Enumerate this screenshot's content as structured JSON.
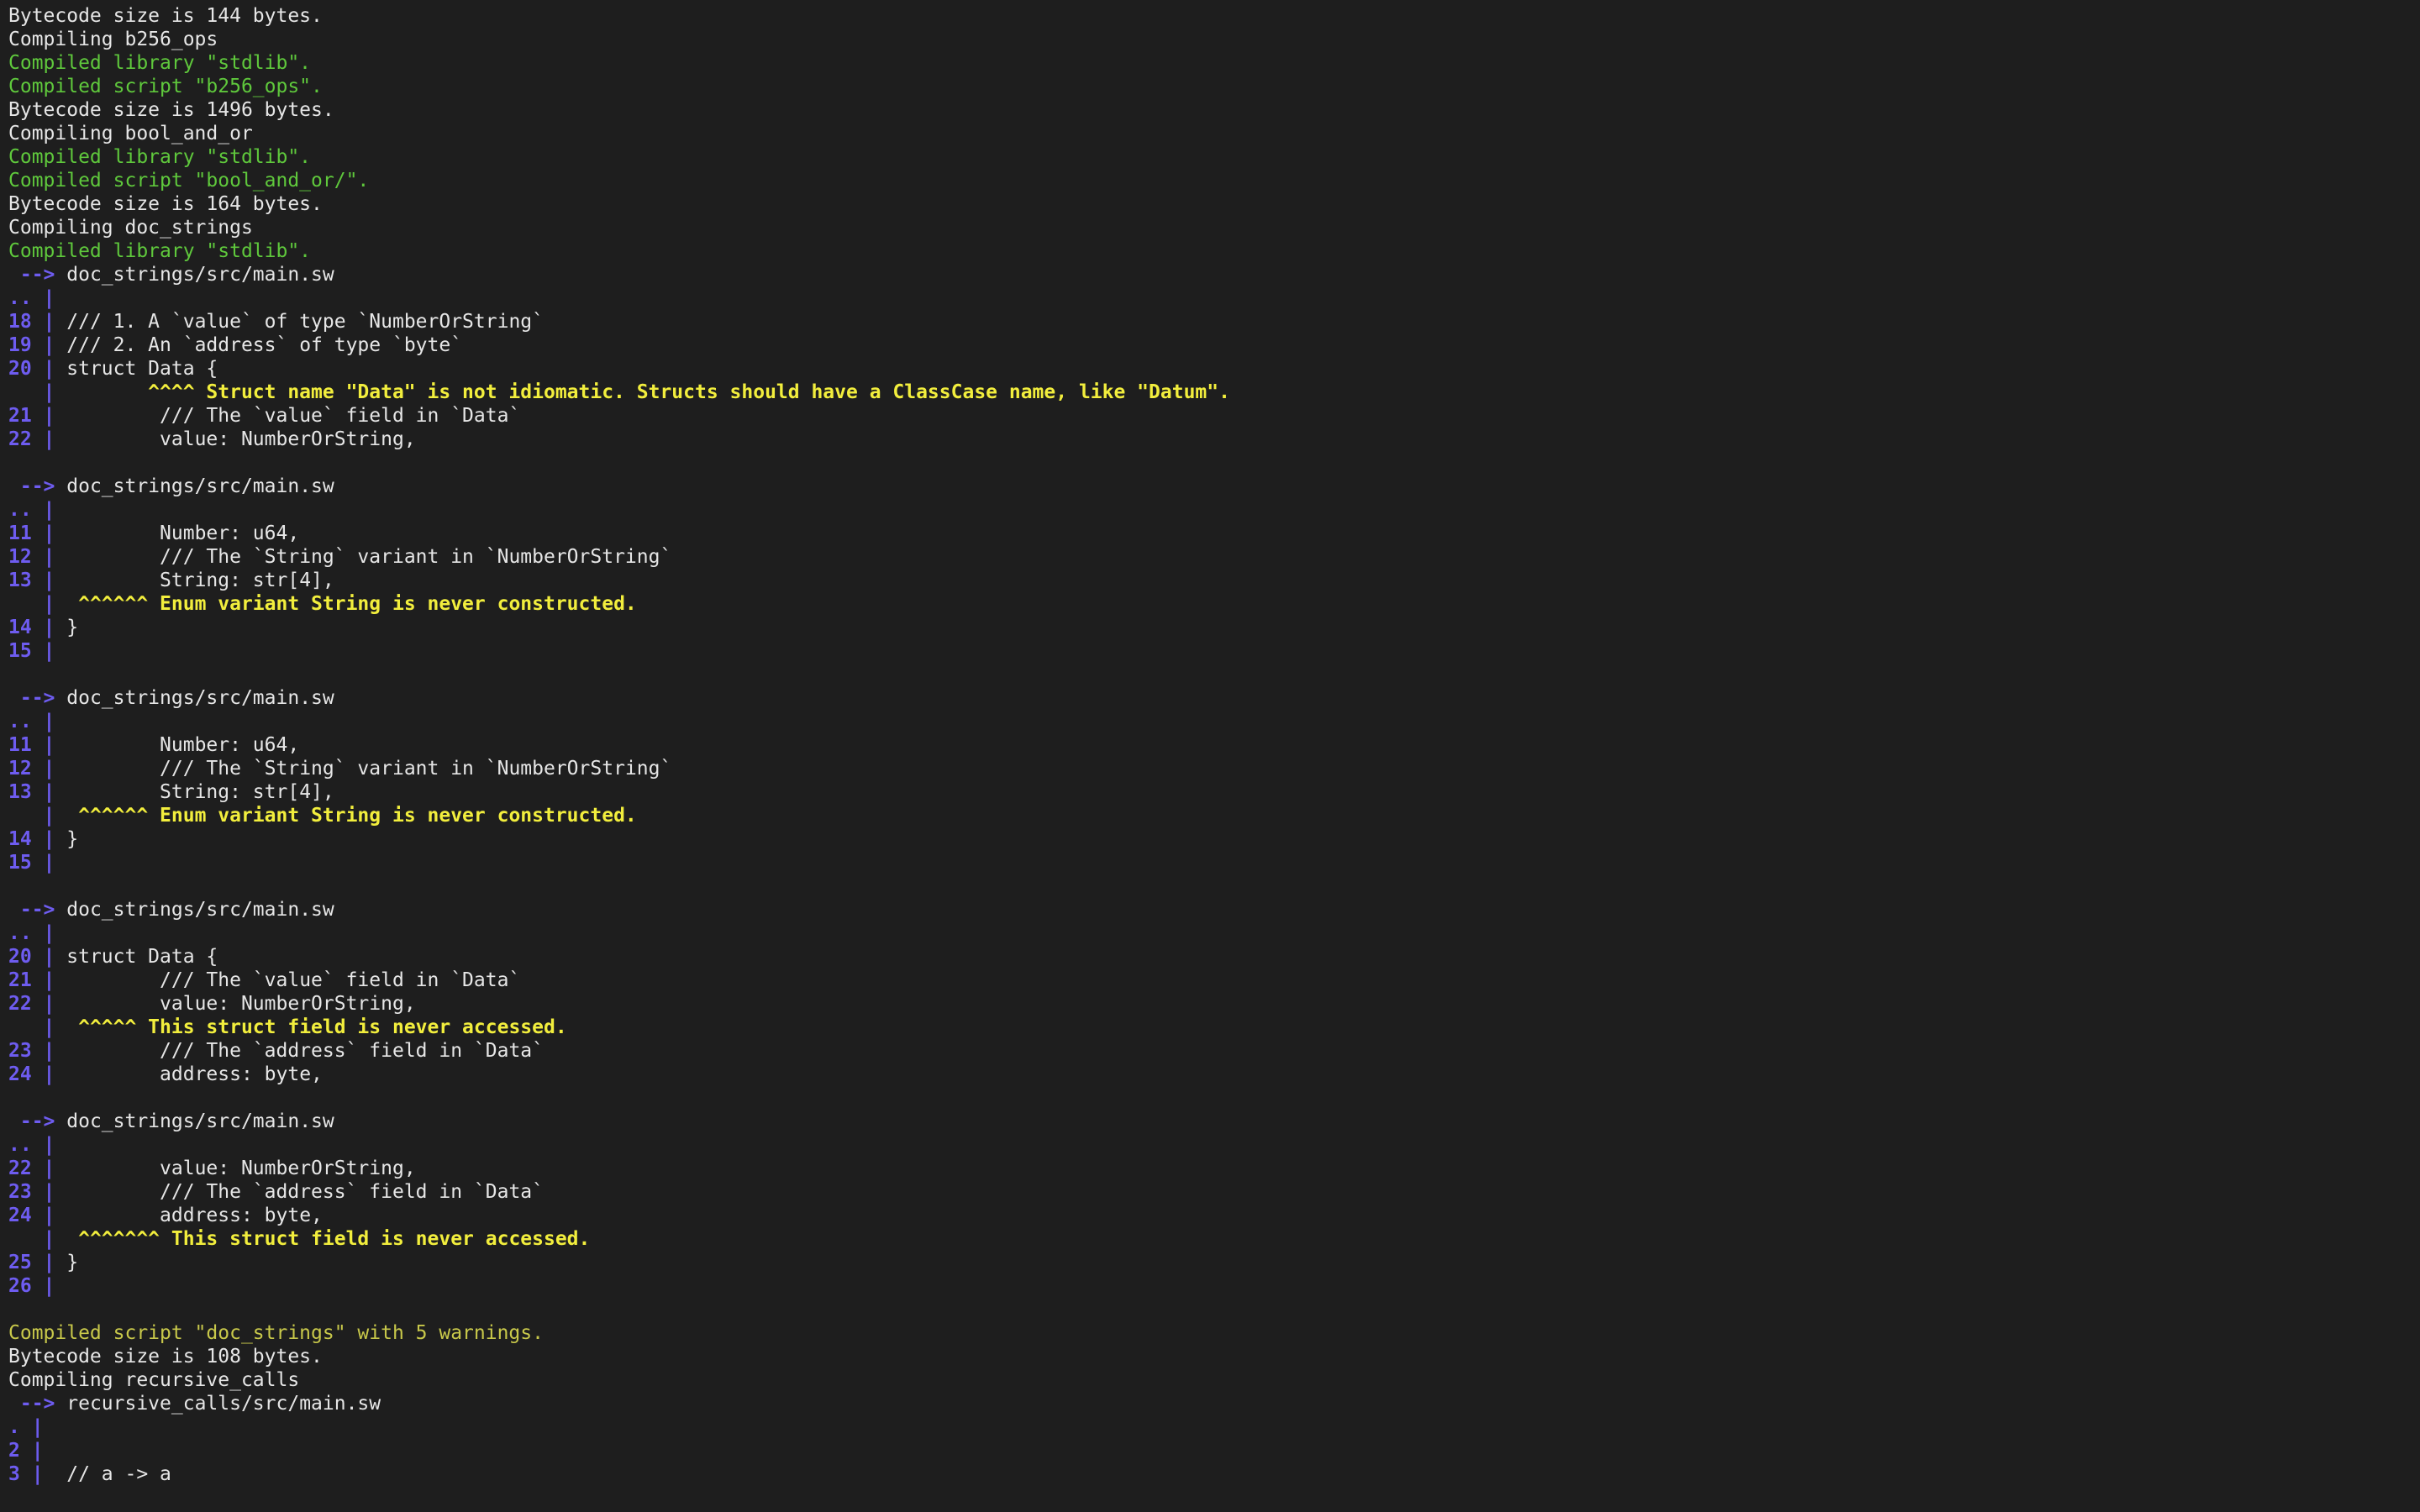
{
  "terminal": {
    "lines": [
      {
        "segments": [
          {
            "text": "Bytecode size is 144 bytes.",
            "style": "plain"
          }
        ]
      },
      {
        "segments": [
          {
            "text": "Compiling b256_ops",
            "style": "plain"
          }
        ]
      },
      {
        "segments": [
          {
            "text": "Compiled library \"stdlib\".",
            "style": "green"
          }
        ]
      },
      {
        "segments": [
          {
            "text": "Compiled script \"b256_ops\".",
            "style": "green"
          }
        ]
      },
      {
        "segments": [
          {
            "text": "Bytecode size is 1496 bytes.",
            "style": "plain"
          }
        ]
      },
      {
        "segments": [
          {
            "text": "Compiling bool_and_or",
            "style": "plain"
          }
        ]
      },
      {
        "segments": [
          {
            "text": "Compiled library \"stdlib\".",
            "style": "green"
          }
        ]
      },
      {
        "segments": [
          {
            "text": "Compiled script \"bool_and_or/\".",
            "style": "green"
          }
        ]
      },
      {
        "segments": [
          {
            "text": "Bytecode size is 164 bytes.",
            "style": "plain"
          }
        ]
      },
      {
        "segments": [
          {
            "text": "Compiling doc_strings",
            "style": "plain"
          }
        ]
      },
      {
        "segments": [
          {
            "text": "Compiled library \"stdlib\".",
            "style": "green"
          }
        ]
      },
      {
        "segments": [
          {
            "text": " --> ",
            "style": "gutter"
          },
          {
            "text": "doc_strings/src/main.sw",
            "style": "plain"
          }
        ]
      },
      {
        "segments": [
          {
            "text": ".. |",
            "style": "gutter"
          }
        ]
      },
      {
        "segments": [
          {
            "text": "18 | ",
            "style": "gutter"
          },
          {
            "text": "/// 1. A `value` of type `NumberOrString`",
            "style": "plain"
          }
        ]
      },
      {
        "segments": [
          {
            "text": "19 | ",
            "style": "gutter"
          },
          {
            "text": "/// 2. An `address` of type `byte`",
            "style": "plain"
          }
        ]
      },
      {
        "segments": [
          {
            "text": "20 | ",
            "style": "gutter"
          },
          {
            "text": "struct Data {",
            "style": "plain"
          }
        ]
      },
      {
        "segments": [
          {
            "text": "   |        ",
            "style": "gutter"
          },
          {
            "text": "^^^^ Struct name \"Data\" is not idiomatic. Structs should have a ClassCase name, like \"Datum\".",
            "style": "warn"
          }
        ]
      },
      {
        "segments": [
          {
            "text": "21 | ",
            "style": "gutter"
          },
          {
            "text": "        /// The `value` field in `Data`",
            "style": "plain"
          }
        ]
      },
      {
        "segments": [
          {
            "text": "22 | ",
            "style": "gutter"
          },
          {
            "text": "        value: NumberOrString,",
            "style": "plain"
          }
        ]
      },
      {
        "segments": [
          {
            "text": "",
            "style": "plain"
          }
        ]
      },
      {
        "segments": [
          {
            "text": " --> ",
            "style": "gutter"
          },
          {
            "text": "doc_strings/src/main.sw",
            "style": "plain"
          }
        ]
      },
      {
        "segments": [
          {
            "text": ".. |",
            "style": "gutter"
          }
        ]
      },
      {
        "segments": [
          {
            "text": "11 | ",
            "style": "gutter"
          },
          {
            "text": "        Number: u64,",
            "style": "plain"
          }
        ]
      },
      {
        "segments": [
          {
            "text": "12 | ",
            "style": "gutter"
          },
          {
            "text": "        /// The `String` variant in `NumberOrString`",
            "style": "plain"
          }
        ]
      },
      {
        "segments": [
          {
            "text": "13 | ",
            "style": "gutter"
          },
          {
            "text": "        String: str[4],",
            "style": "plain"
          }
        ]
      },
      {
        "segments": [
          {
            "text": "   |  ",
            "style": "gutter"
          },
          {
            "text": "^^^^^^ Enum variant String is never constructed.",
            "style": "warn"
          }
        ]
      },
      {
        "segments": [
          {
            "text": "14 | ",
            "style": "gutter"
          },
          {
            "text": "}",
            "style": "plain"
          }
        ]
      },
      {
        "segments": [
          {
            "text": "15 |",
            "style": "gutter"
          }
        ]
      },
      {
        "segments": [
          {
            "text": "",
            "style": "plain"
          }
        ]
      },
      {
        "segments": [
          {
            "text": " --> ",
            "style": "gutter"
          },
          {
            "text": "doc_strings/src/main.sw",
            "style": "plain"
          }
        ]
      },
      {
        "segments": [
          {
            "text": ".. |",
            "style": "gutter"
          }
        ]
      },
      {
        "segments": [
          {
            "text": "11 | ",
            "style": "gutter"
          },
          {
            "text": "        Number: u64,",
            "style": "plain"
          }
        ]
      },
      {
        "segments": [
          {
            "text": "12 | ",
            "style": "gutter"
          },
          {
            "text": "        /// The `String` variant in `NumberOrString`",
            "style": "plain"
          }
        ]
      },
      {
        "segments": [
          {
            "text": "13 | ",
            "style": "gutter"
          },
          {
            "text": "        String: str[4],",
            "style": "plain"
          }
        ]
      },
      {
        "segments": [
          {
            "text": "   |  ",
            "style": "gutter"
          },
          {
            "text": "^^^^^^ Enum variant String is never constructed.",
            "style": "warn"
          }
        ]
      },
      {
        "segments": [
          {
            "text": "14 | ",
            "style": "gutter"
          },
          {
            "text": "}",
            "style": "plain"
          }
        ]
      },
      {
        "segments": [
          {
            "text": "15 |",
            "style": "gutter"
          }
        ]
      },
      {
        "segments": [
          {
            "text": "",
            "style": "plain"
          }
        ]
      },
      {
        "segments": [
          {
            "text": " --> ",
            "style": "gutter"
          },
          {
            "text": "doc_strings/src/main.sw",
            "style": "plain"
          }
        ]
      },
      {
        "segments": [
          {
            "text": ".. |",
            "style": "gutter"
          }
        ]
      },
      {
        "segments": [
          {
            "text": "20 | ",
            "style": "gutter"
          },
          {
            "text": "struct Data {",
            "style": "plain"
          }
        ]
      },
      {
        "segments": [
          {
            "text": "21 | ",
            "style": "gutter"
          },
          {
            "text": "        /// The `value` field in `Data`",
            "style": "plain"
          }
        ]
      },
      {
        "segments": [
          {
            "text": "22 | ",
            "style": "gutter"
          },
          {
            "text": "        value: NumberOrString,",
            "style": "plain"
          }
        ]
      },
      {
        "segments": [
          {
            "text": "   |  ",
            "style": "gutter"
          },
          {
            "text": "^^^^^ This struct field is never accessed.",
            "style": "warn"
          }
        ]
      },
      {
        "segments": [
          {
            "text": "23 | ",
            "style": "gutter"
          },
          {
            "text": "        /// The `address` field in `Data`",
            "style": "plain"
          }
        ]
      },
      {
        "segments": [
          {
            "text": "24 | ",
            "style": "gutter"
          },
          {
            "text": "        address: byte,",
            "style": "plain"
          }
        ]
      },
      {
        "segments": [
          {
            "text": "",
            "style": "plain"
          }
        ]
      },
      {
        "segments": [
          {
            "text": " --> ",
            "style": "gutter"
          },
          {
            "text": "doc_strings/src/main.sw",
            "style": "plain"
          }
        ]
      },
      {
        "segments": [
          {
            "text": ".. |",
            "style": "gutter"
          }
        ]
      },
      {
        "segments": [
          {
            "text": "22 | ",
            "style": "gutter"
          },
          {
            "text": "        value: NumberOrString,",
            "style": "plain"
          }
        ]
      },
      {
        "segments": [
          {
            "text": "23 | ",
            "style": "gutter"
          },
          {
            "text": "        /// The `address` field in `Data`",
            "style": "plain"
          }
        ]
      },
      {
        "segments": [
          {
            "text": "24 | ",
            "style": "gutter"
          },
          {
            "text": "        address: byte,",
            "style": "plain"
          }
        ]
      },
      {
        "segments": [
          {
            "text": "   |  ",
            "style": "gutter"
          },
          {
            "text": "^^^^^^^ This struct field is never accessed.",
            "style": "warn"
          }
        ]
      },
      {
        "segments": [
          {
            "text": "25 | ",
            "style": "gutter"
          },
          {
            "text": "}",
            "style": "plain"
          }
        ]
      },
      {
        "segments": [
          {
            "text": "26 |",
            "style": "gutter"
          }
        ]
      },
      {
        "segments": [
          {
            "text": "",
            "style": "plain"
          }
        ]
      },
      {
        "segments": [
          {
            "text": "Compiled script \"doc_strings\" with 5 warnings.",
            "style": "olive"
          }
        ]
      },
      {
        "segments": [
          {
            "text": "Bytecode size is 108 bytes.",
            "style": "plain"
          }
        ]
      },
      {
        "segments": [
          {
            "text": "Compiling recursive_calls",
            "style": "plain"
          }
        ]
      },
      {
        "segments": [
          {
            "text": " --> ",
            "style": "gutter"
          },
          {
            "text": "recursive_calls/src/main.sw",
            "style": "plain"
          }
        ]
      },
      {
        "segments": [
          {
            "text": ". |",
            "style": "gutter"
          }
        ]
      },
      {
        "segments": [
          {
            "text": "2 |",
            "style": "gutter"
          }
        ]
      },
      {
        "segments": [
          {
            "text": "3 | ",
            "style": "gutter"
          },
          {
            "text": " // a -> a",
            "style": "plain"
          }
        ]
      }
    ]
  }
}
